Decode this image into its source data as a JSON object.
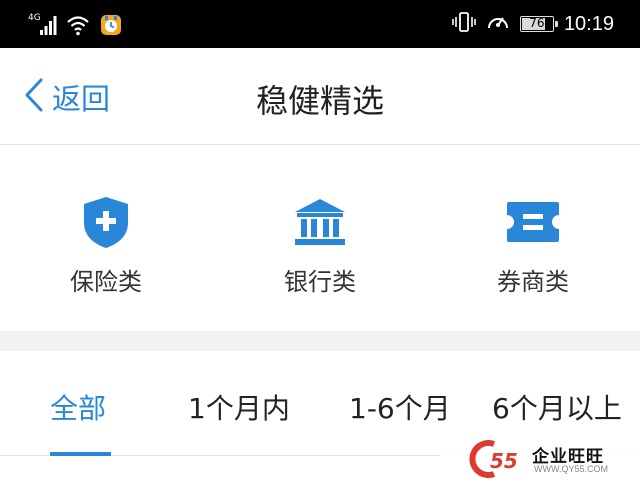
{
  "status_bar": {
    "network_label": "4G",
    "battery_level": 76,
    "battery_text": "76",
    "time": "10:19",
    "icons": [
      "signal-icon",
      "wifi-icon",
      "app-notification-icon",
      "vibrate-icon",
      "data-speed-icon",
      "battery-icon"
    ]
  },
  "nav": {
    "back_label": "返回",
    "title": "稳健精选"
  },
  "categories": [
    {
      "label": "保险类",
      "icon": "shield-plus-icon"
    },
    {
      "label": "银行类",
      "icon": "bank-icon"
    },
    {
      "label": "券商类",
      "icon": "ticket-icon"
    }
  ],
  "tabs": [
    {
      "label": "全部",
      "active": true
    },
    {
      "label": "1个月内",
      "active": false
    },
    {
      "label": "1-6个月",
      "active": false
    },
    {
      "label": "6个月以上",
      "active": false
    }
  ],
  "watermark": {
    "logo_text": "55",
    "title": "企业旺旺",
    "url": "WWW.QY55.COM"
  },
  "colors": {
    "accent": "#2a87d8",
    "status_bar_bg": "#000000",
    "divider_band": "#f2f2f2"
  }
}
